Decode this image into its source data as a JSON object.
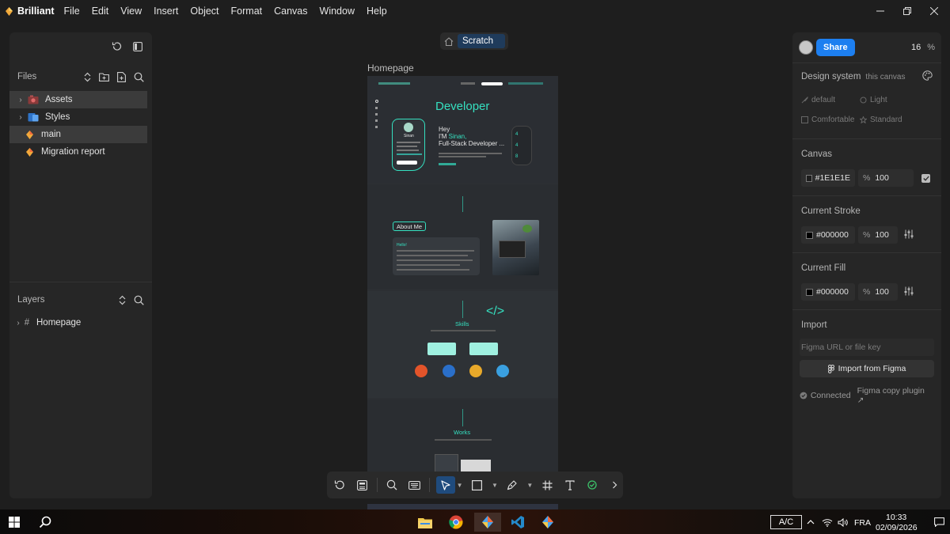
{
  "app": {
    "name": "Brilliant",
    "logo_icon": "brilliant-logo-icon"
  },
  "menu": [
    "File",
    "Edit",
    "View",
    "Insert",
    "Object",
    "Format",
    "Canvas",
    "Window",
    "Help"
  ],
  "left_panel": {
    "files_label": "Files",
    "files": [
      {
        "label": "Assets",
        "expandable": true,
        "active": true
      },
      {
        "label": "Styles",
        "expandable": true,
        "active": false
      },
      {
        "label": "main",
        "expandable": false,
        "active": true
      },
      {
        "label": "Migration report",
        "expandable": false,
        "active": false
      }
    ],
    "layers_label": "Layers",
    "layers": [
      {
        "label": "Homepage",
        "type": "frame"
      }
    ]
  },
  "canvas": {
    "breadcrumb": "Scratch",
    "frame_label": "Homepage",
    "artboard": {
      "hero_title": "Developer",
      "hero_hey": "Hey",
      "hero_im": "I'M ",
      "hero_name": "Sinan,",
      "hero_role": "Full-Stack Developer ...",
      "card_name": "Sinan",
      "about_title": "About Me",
      "about_hello": "Hello!",
      "skills_title": "Skills",
      "code_icon_text": "</>",
      "works_title": "Works"
    }
  },
  "toolbar": {
    "tools": [
      "undo-icon",
      "calculator-icon",
      "search-icon",
      "keyboard-icon",
      "pointer-icon",
      "rectangle-icon",
      "pen-icon",
      "frame-icon",
      "text-icon",
      "check-circle-icon",
      "chevron-right-icon"
    ]
  },
  "right_panel": {
    "share_label": "Share",
    "zoom_value": "16",
    "zoom_unit": "%",
    "design_system": {
      "title": "Design system",
      "subtitle": "this canvas",
      "options": [
        "default",
        "Light",
        "Comfortable",
        "Standard"
      ]
    },
    "canvas": {
      "title": "Canvas",
      "color": "#1E1E1E",
      "opacity_unit": "%",
      "opacity": "100"
    },
    "stroke": {
      "title": "Current Stroke",
      "color": "#000000",
      "opacity_unit": "%",
      "opacity": "100"
    },
    "fill": {
      "title": "Current Fill",
      "color": "#000000",
      "opacity_unit": "%",
      "opacity": "100"
    },
    "import": {
      "title": "Import",
      "placeholder": "Figma URL or file key",
      "button_label": "Import from Figma",
      "status": "Connected",
      "plugin_label": "Figma copy plugin ↗"
    }
  },
  "taskbar": {
    "ac_label": "A/C",
    "language": "FRA",
    "time": "10:33",
    "date": "02/09/2026"
  },
  "colors": {
    "accent": "#1d7ff0",
    "teal": "#35e0c0",
    "background": "#1e1e1e",
    "panel": "#262626"
  }
}
